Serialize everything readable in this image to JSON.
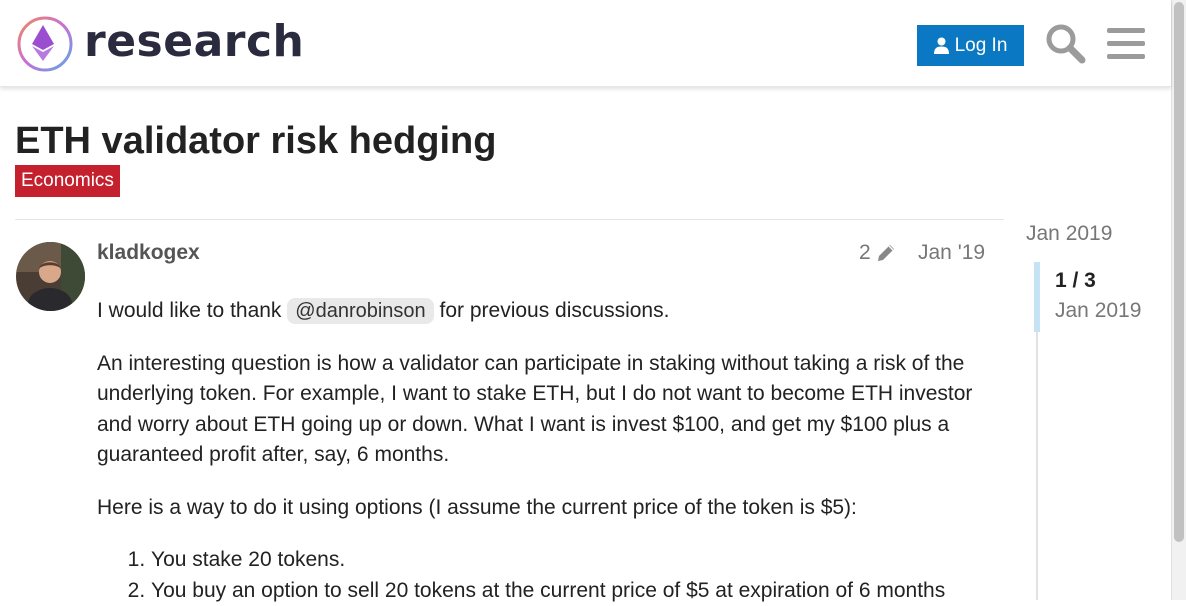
{
  "header": {
    "site_name": "research",
    "login_label": "Log In",
    "icons": {
      "logo": "ethereum-research-logo",
      "user": "user-icon",
      "search": "search-icon",
      "menu": "hamburger-menu-icon"
    },
    "colors": {
      "login_bg": "#0a78c2"
    }
  },
  "topic": {
    "title": "ETH validator risk hedging",
    "category": "Economics",
    "category_color": "#c4202e"
  },
  "post": {
    "username": "kladkogex",
    "edit_count": "2",
    "date": "Jan '19",
    "para1_before": "I would like to thank ",
    "mention": "@danrobinson",
    "para1_after": " for previous discussions.",
    "para2": "An interesting question is how a validator can participate in staking without taking a risk of the underlying token. For example, I want to stake ETH, but I do not want to become ETH investor and worry about ETH going up or down. What I want is invest $100, and get my $100 plus a guaranteed profit after, say, 6 months.",
    "para3": "Here is a way to do it using options (I assume the current price of the token is $5):",
    "list": [
      "You stake 20 tokens.",
      "You buy an option to sell 20 tokens at the current price of $5 at expiration of 6 months"
    ]
  },
  "timeline": {
    "top_date": "Jan 2019",
    "count": "1 / 3",
    "current_date": "Jan 2019"
  }
}
